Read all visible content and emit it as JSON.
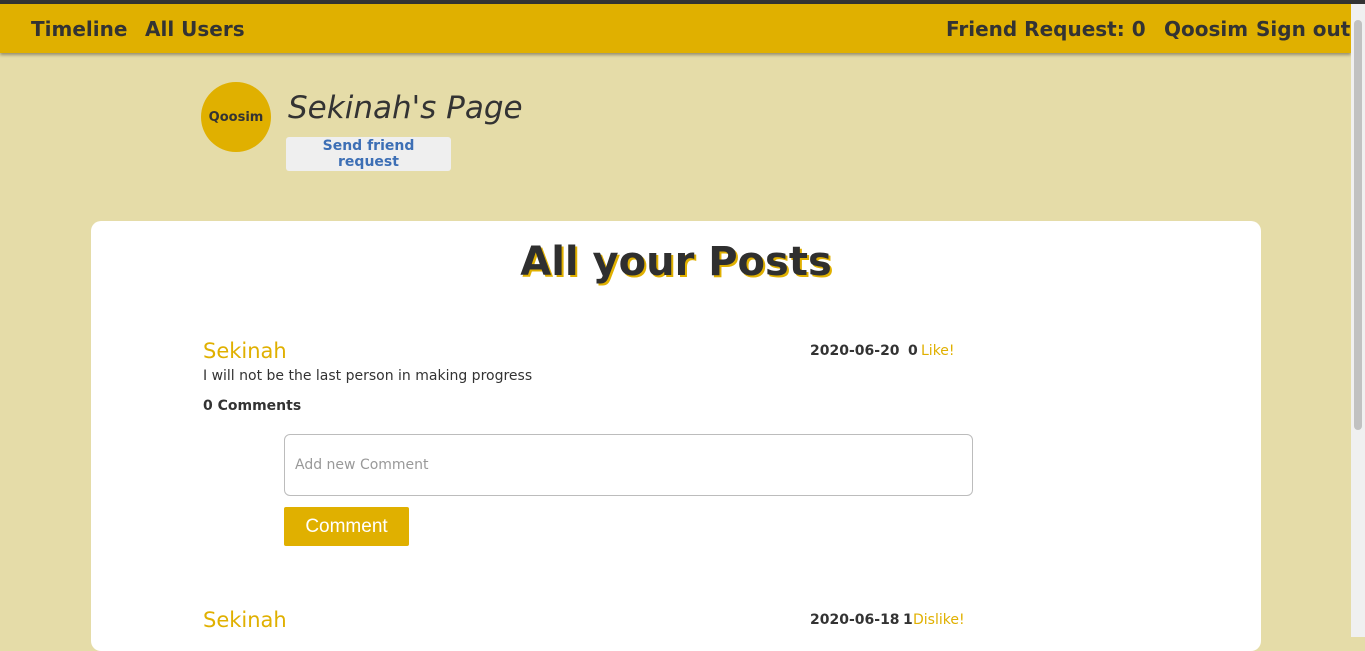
{
  "navbar": {
    "timeline_label": "Timeline",
    "all_users_label": "All Users",
    "friend_request_label": "Friend Request: 0",
    "user_label": "Qoosim",
    "sign_out_label": "Sign out"
  },
  "profile": {
    "avatar_text": "Qoosim",
    "title": "Sekinah's Page",
    "friend_request_button": "Send friend request"
  },
  "main": {
    "heading": "All your Posts",
    "posts": [
      {
        "author": "Sekinah",
        "date": "2020-06-20",
        "likes": "0",
        "like_action": "Like!",
        "body": "I will not be the last person in making progress",
        "comments_label": "0 Comments",
        "comment_placeholder": "Add new Comment",
        "comment_button": "Comment"
      },
      {
        "author": "Sekinah",
        "date": "2020-06-18",
        "likes": "1",
        "like_action": "Dislike!"
      }
    ]
  },
  "colors": {
    "accent": "#e0b000",
    "page_background": "#e5dca8",
    "link_blue": "#3d6fb5"
  }
}
